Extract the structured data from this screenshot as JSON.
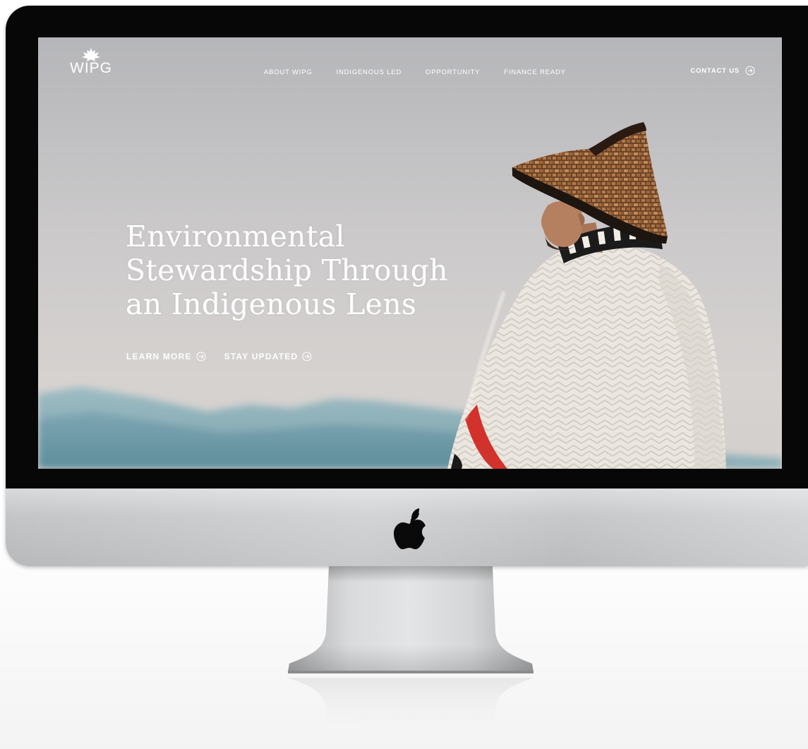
{
  "brand": {
    "name": "WIPG"
  },
  "nav": {
    "items": [
      {
        "label": "ABOUT WIPG"
      },
      {
        "label": "INDIGENOUS LED"
      },
      {
        "label": "OPPORTUNITY"
      },
      {
        "label": "FINANCE READY"
      }
    ],
    "contact_label": "CONTACT US"
  },
  "hero": {
    "title_lines": [
      "Environmental",
      "Stewardship Through",
      "an Indigenous Lens"
    ],
    "ctas": [
      {
        "label": "LEARN MORE"
      },
      {
        "label": "STAY UPDATED"
      }
    ]
  },
  "colors": {
    "sky": "#c9c8ca",
    "mountains": "#6f98a8",
    "sweater": "#e8e4dc",
    "hat": "#8a5a36",
    "accent_red": "#d1332c",
    "bezel": "#070707",
    "chin": "#c3c5c7"
  },
  "icons": {
    "logo": "maple-leaf-icon",
    "cta_arrow": "circle-arrow-right-icon",
    "device": "apple-logo-icon"
  }
}
